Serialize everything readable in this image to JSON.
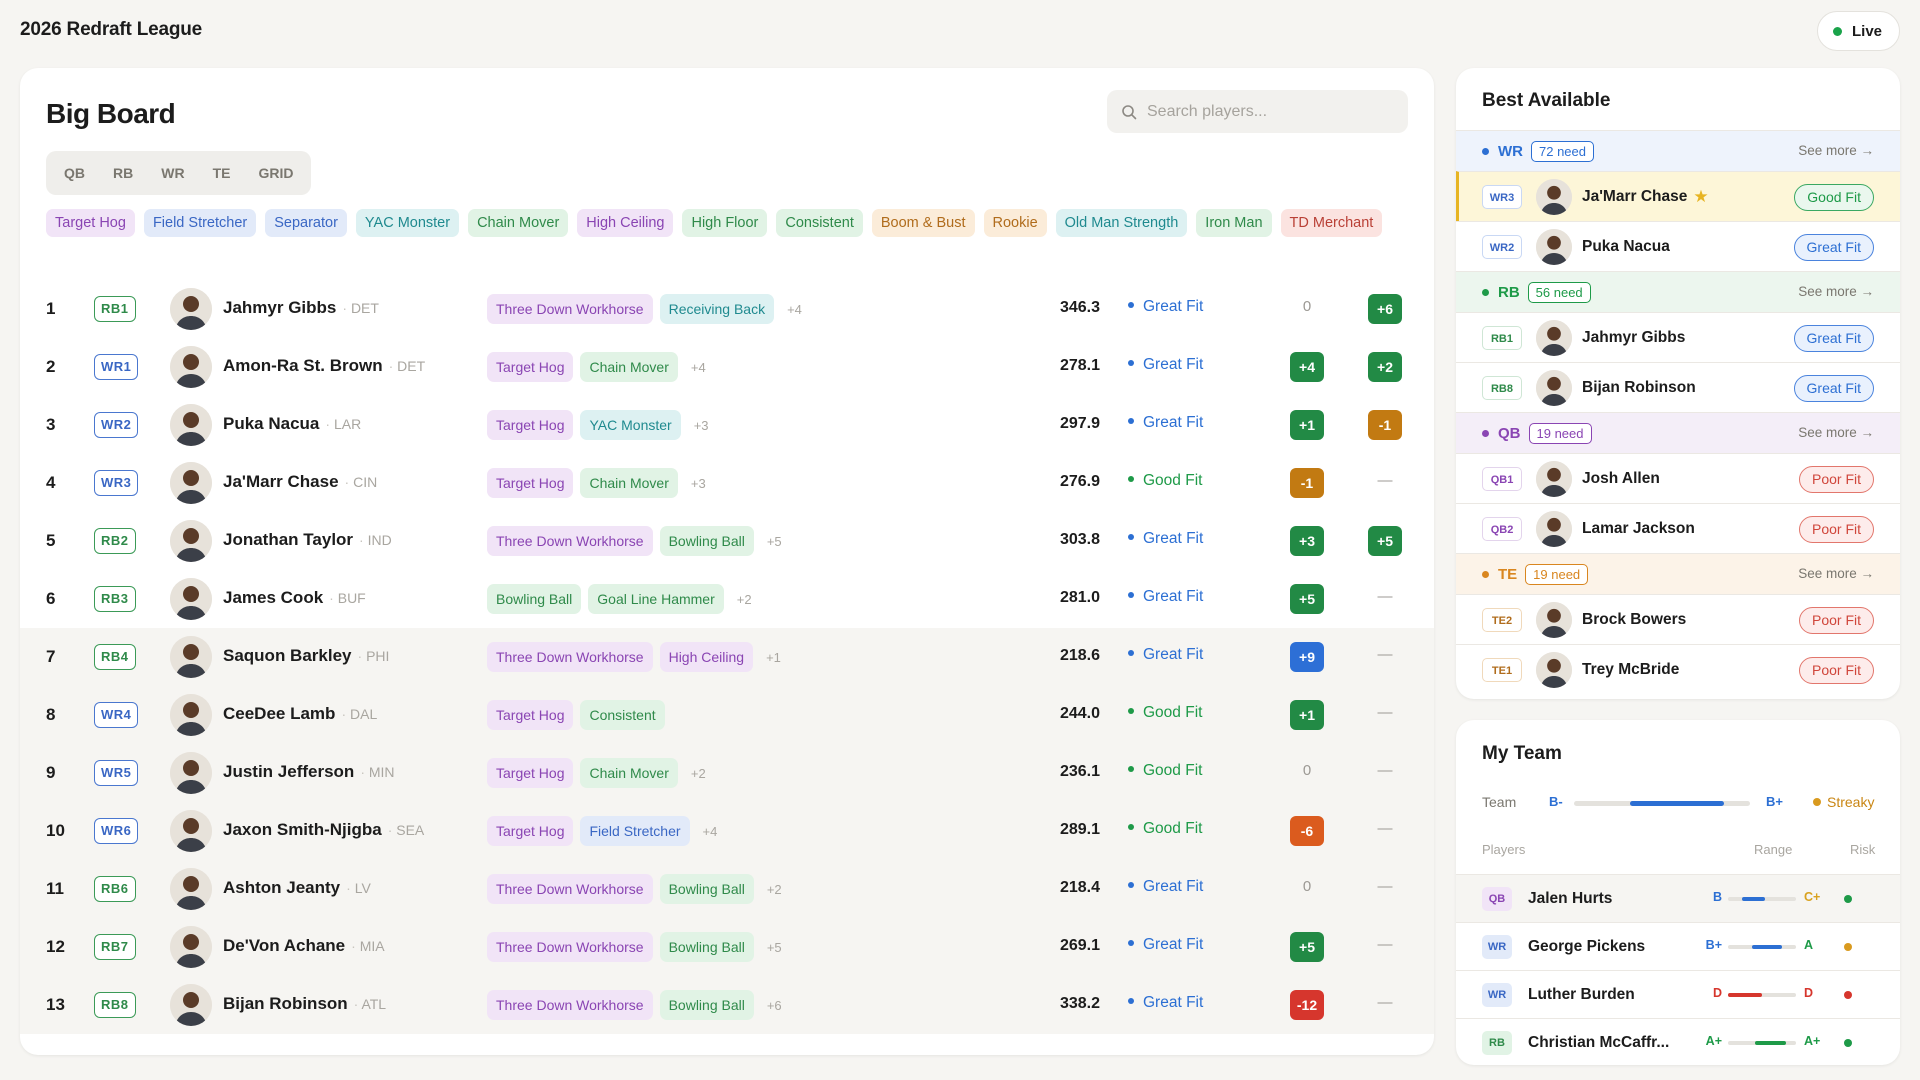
{
  "app": {
    "title": "2026 Redraft League",
    "live_label": "Live"
  },
  "board": {
    "title": "Big Board",
    "search_placeholder": "Search players...",
    "segments": [
      "QB",
      "RB",
      "WR",
      "TE",
      "GRID"
    ],
    "archetypes": [
      {
        "label": "Target Hog",
        "color": "purple"
      },
      {
        "label": "Field Stretcher",
        "color": "blue"
      },
      {
        "label": "Separator",
        "color": "blue"
      },
      {
        "label": "YAC Monster",
        "color": "teal"
      },
      {
        "label": "Chain Mover",
        "color": "green"
      },
      {
        "label": "High Ceiling",
        "color": "purple"
      },
      {
        "label": "High Floor",
        "color": "green"
      },
      {
        "label": "Consistent",
        "color": "green"
      },
      {
        "label": "Boom & Bust",
        "color": "orange"
      },
      {
        "label": "Rookie",
        "color": "orange"
      },
      {
        "label": "Old Man Strength",
        "color": "teal"
      },
      {
        "label": "Iron Man",
        "color": "green"
      },
      {
        "label": "TD Merchant",
        "color": "red"
      }
    ],
    "rows": [
      {
        "rank": "1",
        "pos": "RB1",
        "pos_type": "rb",
        "name": "Jahmyr Gibbs",
        "team": "DET",
        "tags": [
          {
            "label": "Three Down Workhorse",
            "color": "purple"
          },
          {
            "label": "Receiving Back",
            "color": "teal"
          }
        ],
        "more": "+4",
        "score": "346.3",
        "fit": "Great Fit",
        "fit_type": "great",
        "d1": "0",
        "d1_type": "plain",
        "d2": "+6",
        "d2_type": "g"
      },
      {
        "rank": "2",
        "pos": "WR1",
        "pos_type": "wr",
        "name": "Amon-Ra St. Brown",
        "team": "DET",
        "tags": [
          {
            "label": "Target Hog",
            "color": "purple"
          },
          {
            "label": "Chain Mover",
            "color": "green"
          }
        ],
        "more": "+4",
        "score": "278.1",
        "fit": "Great Fit",
        "fit_type": "great",
        "d1": "+4",
        "d1_type": "g",
        "d2": "+2",
        "d2_type": "g"
      },
      {
        "rank": "3",
        "pos": "WR2",
        "pos_type": "wr",
        "name": "Puka Nacua",
        "team": "LAR",
        "tags": [
          {
            "label": "Target Hog",
            "color": "purple"
          },
          {
            "label": "YAC Monster",
            "color": "teal"
          }
        ],
        "more": "+3",
        "score": "297.9",
        "fit": "Great Fit",
        "fit_type": "great",
        "d1": "+1",
        "d1_type": "g",
        "d2": "-1",
        "d2_type": "o"
      },
      {
        "rank": "4",
        "pos": "WR3",
        "pos_type": "wr",
        "name": "Ja'Marr Chase",
        "team": "CIN",
        "tags": [
          {
            "label": "Target Hog",
            "color": "purple"
          },
          {
            "label": "Chain Mover",
            "color": "green"
          }
        ],
        "more": "+3",
        "score": "276.9",
        "fit": "Good Fit",
        "fit_type": "good",
        "d1": "-1",
        "d1_type": "o",
        "d2": "—",
        "d2_type": "plain"
      },
      {
        "rank": "5",
        "pos": "RB2",
        "pos_type": "rb",
        "name": "Jonathan Taylor",
        "team": "IND",
        "tags": [
          {
            "label": "Three Down Workhorse",
            "color": "purple"
          },
          {
            "label": "Bowling Ball",
            "color": "green"
          }
        ],
        "more": "+5",
        "score": "303.8",
        "fit": "Great Fit",
        "fit_type": "great",
        "d1": "+3",
        "d1_type": "g",
        "d2": "+5",
        "d2_type": "g"
      },
      {
        "rank": "6",
        "pos": "RB3",
        "pos_type": "rb",
        "name": "James Cook",
        "team": "BUF",
        "tags": [
          {
            "label": "Bowling Ball",
            "color": "green"
          },
          {
            "label": "Goal Line Hammer",
            "color": "green"
          }
        ],
        "more": "+2",
        "score": "281.0",
        "fit": "Great Fit",
        "fit_type": "great",
        "d1": "+5",
        "d1_type": "g",
        "d2": "—",
        "d2_type": "plain"
      },
      {
        "rank": "7",
        "pos": "RB4",
        "pos_type": "rb",
        "name": "Saquon Barkley",
        "team": "PHI",
        "tags": [
          {
            "label": "Three Down Workhorse",
            "color": "purple"
          },
          {
            "label": "High Ceiling",
            "color": "purple"
          }
        ],
        "more": "+1",
        "score": "218.6",
        "fit": "Great Fit",
        "fit_type": "great",
        "d1": "+9",
        "d1_type": "b",
        "d2": "—",
        "d2_type": "plain"
      },
      {
        "rank": "8",
        "pos": "WR4",
        "pos_type": "wr",
        "name": "CeeDee Lamb",
        "team": "DAL",
        "tags": [
          {
            "label": "Target Hog",
            "color": "purple"
          },
          {
            "label": "Consistent",
            "color": "green"
          }
        ],
        "more": "",
        "score": "244.0",
        "fit": "Good Fit",
        "fit_type": "good",
        "d1": "+1",
        "d1_type": "g",
        "d2": "—",
        "d2_type": "plain"
      },
      {
        "rank": "9",
        "pos": "WR5",
        "pos_type": "wr",
        "name": "Justin Jefferson",
        "team": "MIN",
        "tags": [
          {
            "label": "Target Hog",
            "color": "purple"
          },
          {
            "label": "Chain Mover",
            "color": "green"
          }
        ],
        "more": "+2",
        "score": "236.1",
        "fit": "Good Fit",
        "fit_type": "good",
        "d1": "0",
        "d1_type": "plain",
        "d2": "—",
        "d2_type": "plain"
      },
      {
        "rank": "10",
        "pos": "WR6",
        "pos_type": "wr",
        "name": "Jaxon Smith-Njigba",
        "team": "SEA",
        "tags": [
          {
            "label": "Target Hog",
            "color": "purple"
          },
          {
            "label": "Field Stretcher",
            "color": "blue"
          }
        ],
        "more": "+4",
        "score": "289.1",
        "fit": "Good Fit",
        "fit_type": "good",
        "d1": "-6",
        "d1_type": "or",
        "d2": "—",
        "d2_type": "plain"
      },
      {
        "rank": "11",
        "pos": "RB6",
        "pos_type": "rb",
        "name": "Ashton Jeanty",
        "team": "LV",
        "tags": [
          {
            "label": "Three Down Workhorse",
            "color": "purple"
          },
          {
            "label": "Bowling Ball",
            "color": "green"
          }
        ],
        "more": "+2",
        "score": "218.4",
        "fit": "Great Fit",
        "fit_type": "great",
        "d1": "0",
        "d1_type": "plain",
        "d2": "—",
        "d2_type": "plain"
      },
      {
        "rank": "12",
        "pos": "RB7",
        "pos_type": "rb",
        "name": "De'Von Achane",
        "team": "MIA",
        "tags": [
          {
            "label": "Three Down Workhorse",
            "color": "purple"
          },
          {
            "label": "Bowling Ball",
            "color": "green"
          }
        ],
        "more": "+5",
        "score": "269.1",
        "fit": "Great Fit",
        "fit_type": "great",
        "d1": "+5",
        "d1_type": "g",
        "d2": "—",
        "d2_type": "plain"
      },
      {
        "rank": "13",
        "pos": "RB8",
        "pos_type": "rb",
        "name": "Bijan Robinson",
        "team": "ATL",
        "tags": [
          {
            "label": "Three Down Workhorse",
            "color": "purple"
          },
          {
            "label": "Bowling Ball",
            "color": "green"
          }
        ],
        "more": "+6",
        "score": "338.2",
        "fit": "Great Fit",
        "fit_type": "great",
        "d1": "-12",
        "d1_type": "r",
        "d2": "—",
        "d2_type": "plain"
      }
    ]
  },
  "best_available": {
    "title": "Best Available",
    "see_more": "See more",
    "groups": [
      {
        "pos": "WR",
        "need": "72 need",
        "type": "wr",
        "color": "#2c6fd3",
        "players": [
          {
            "pos": "WR3",
            "name": "Ja'Marr Chase",
            "fit": "Good Fit",
            "fit_type": "good",
            "highlight": true
          },
          {
            "pos": "WR2",
            "name": "Puka Nacua",
            "fit": "Great Fit",
            "fit_type": "great",
            "highlight": false
          }
        ]
      },
      {
        "pos": "RB",
        "need": "56 need",
        "type": "rb",
        "color": "#1e9a48",
        "players": [
          {
            "pos": "RB1",
            "name": "Jahmyr Gibbs",
            "fit": "Great Fit",
            "fit_type": "great",
            "highlight": false
          },
          {
            "pos": "RB8",
            "name": "Bijan Robinson",
            "fit": "Great Fit",
            "fit_type": "great",
            "highlight": false
          }
        ]
      },
      {
        "pos": "QB",
        "need": "19 need",
        "type": "qb",
        "color": "#8a45b3",
        "players": [
          {
            "pos": "QB1",
            "name": "Josh Allen",
            "fit": "Poor Fit",
            "fit_type": "poor",
            "highlight": false
          },
          {
            "pos": "QB2",
            "name": "Lamar Jackson",
            "fit": "Poor Fit",
            "fit_type": "poor",
            "highlight": false
          }
        ]
      },
      {
        "pos": "TE",
        "need": "19 need",
        "type": "te",
        "color": "#d9861f",
        "players": [
          {
            "pos": "TE2",
            "name": "Brock Bowers",
            "fit": "Poor Fit",
            "fit_type": "poor",
            "highlight": false
          },
          {
            "pos": "TE1",
            "name": "Trey McBride",
            "fit": "Poor Fit",
            "fit_type": "poor",
            "highlight": false
          }
        ]
      }
    ]
  },
  "my_team": {
    "title": "My Team",
    "team_label": "Team",
    "grade_low": "B-",
    "grade_high": "B+",
    "streak_label": "Streaky",
    "col_players": "Players",
    "col_range": "Range",
    "col_risk": "Risk",
    "players": [
      {
        "pos": "QB",
        "type": "qb",
        "name": "Jalen Hurts",
        "lo": "B",
        "hi": "C+",
        "lo_color": "#2c6fd3",
        "hi_color": "#d9a21f",
        "fill_color": "#2c6fd3",
        "risk_color": "#1e9a48",
        "fill_start": 0.2,
        "fill_end": 0.55
      },
      {
        "pos": "WR",
        "type": "wr",
        "name": "George Pickens",
        "lo": "B+",
        "hi": "A",
        "lo_color": "#2c6fd3",
        "hi_color": "#1e9a48",
        "fill_color": "#2c6fd3",
        "risk_color": "#d99a1f",
        "fill_start": 0.35,
        "fill_end": 0.8
      },
      {
        "pos": "WR",
        "type": "wr",
        "name": "Luther Burden",
        "lo": "D",
        "hi": "D",
        "lo_color": "#d6362d",
        "hi_color": "#d6362d",
        "fill_color": "#d6362d",
        "risk_color": "#d6362d",
        "fill_start": 0.0,
        "fill_end": 0.5
      },
      {
        "pos": "RB",
        "type": "rb",
        "name": "Christian McCaffr...",
        "lo": "A+",
        "hi": "A+",
        "lo_color": "#1e9a48",
        "hi_color": "#1e9a48",
        "fill_color": "#1e9a48",
        "risk_color": "#1e9a48",
        "fill_start": 0.4,
        "fill_end": 0.85
      }
    ]
  }
}
